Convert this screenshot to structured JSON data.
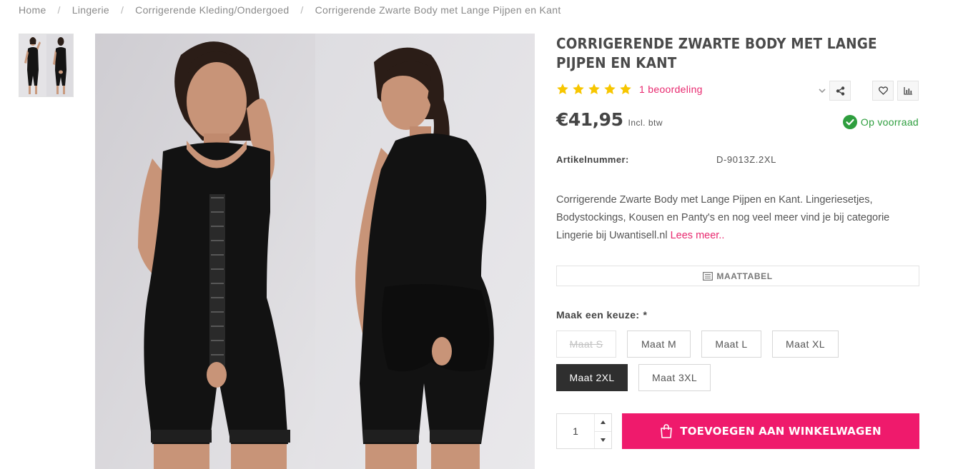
{
  "breadcrumb": [
    "Home",
    "Lingerie",
    "Corrigerende Kleding/Ondergoed",
    "Corrigerende Zwarte Body met Lange Pijpen en Kant"
  ],
  "breadcrumb_separator": "/",
  "product": {
    "title": "Corrigerende Zwarte Body met Lange Pijpen en Kant",
    "rating": 5,
    "rating_max": 5,
    "review_link": "1 beoordeling",
    "price": "€41,95",
    "price_note": "Incl. btw",
    "stock": "Op voorraad",
    "sku_label": "Artikelnummer:",
    "sku_value": "D-9013Z.2XL",
    "description": "Corrigerende Zwarte Body met Lange Pijpen en Kant. Lingeriesetjes, Bodystockings, Kousen en Panty's en nog veel meer vind je bij categorie Lingerie bij Uwantisell.nl",
    "read_more": "Lees meer..",
    "size_chart_label": "MAATTABEL"
  },
  "variant": {
    "label": "Maak een keuze:",
    "required_mark": "*",
    "sizes": [
      {
        "label": "Maat S",
        "state": "unavailable"
      },
      {
        "label": "Maat M",
        "state": "available"
      },
      {
        "label": "Maat L",
        "state": "available"
      },
      {
        "label": "Maat XL",
        "state": "available"
      },
      {
        "label": "Maat 2XL",
        "state": "selected"
      },
      {
        "label": "Maat 3XL",
        "state": "available"
      }
    ]
  },
  "cart": {
    "quantity": "1",
    "add_label": "TOEVOEGEN AAN WINKELWAGEN"
  },
  "colors": {
    "accent_pink": "#ef1a6c",
    "link_pink": "#e8296f",
    "star_yellow": "#f7c600",
    "stock_green": "#2e9e3e",
    "selected_dark": "#2f2f2f"
  },
  "icons": {
    "share": "share-icon",
    "wishlist": "heart-icon",
    "compare": "bar-chart-icon",
    "chevron": "chevron-down-icon",
    "stock": "check-circle-icon",
    "size_chart": "list-icon",
    "cart": "shopping-bag-icon"
  }
}
